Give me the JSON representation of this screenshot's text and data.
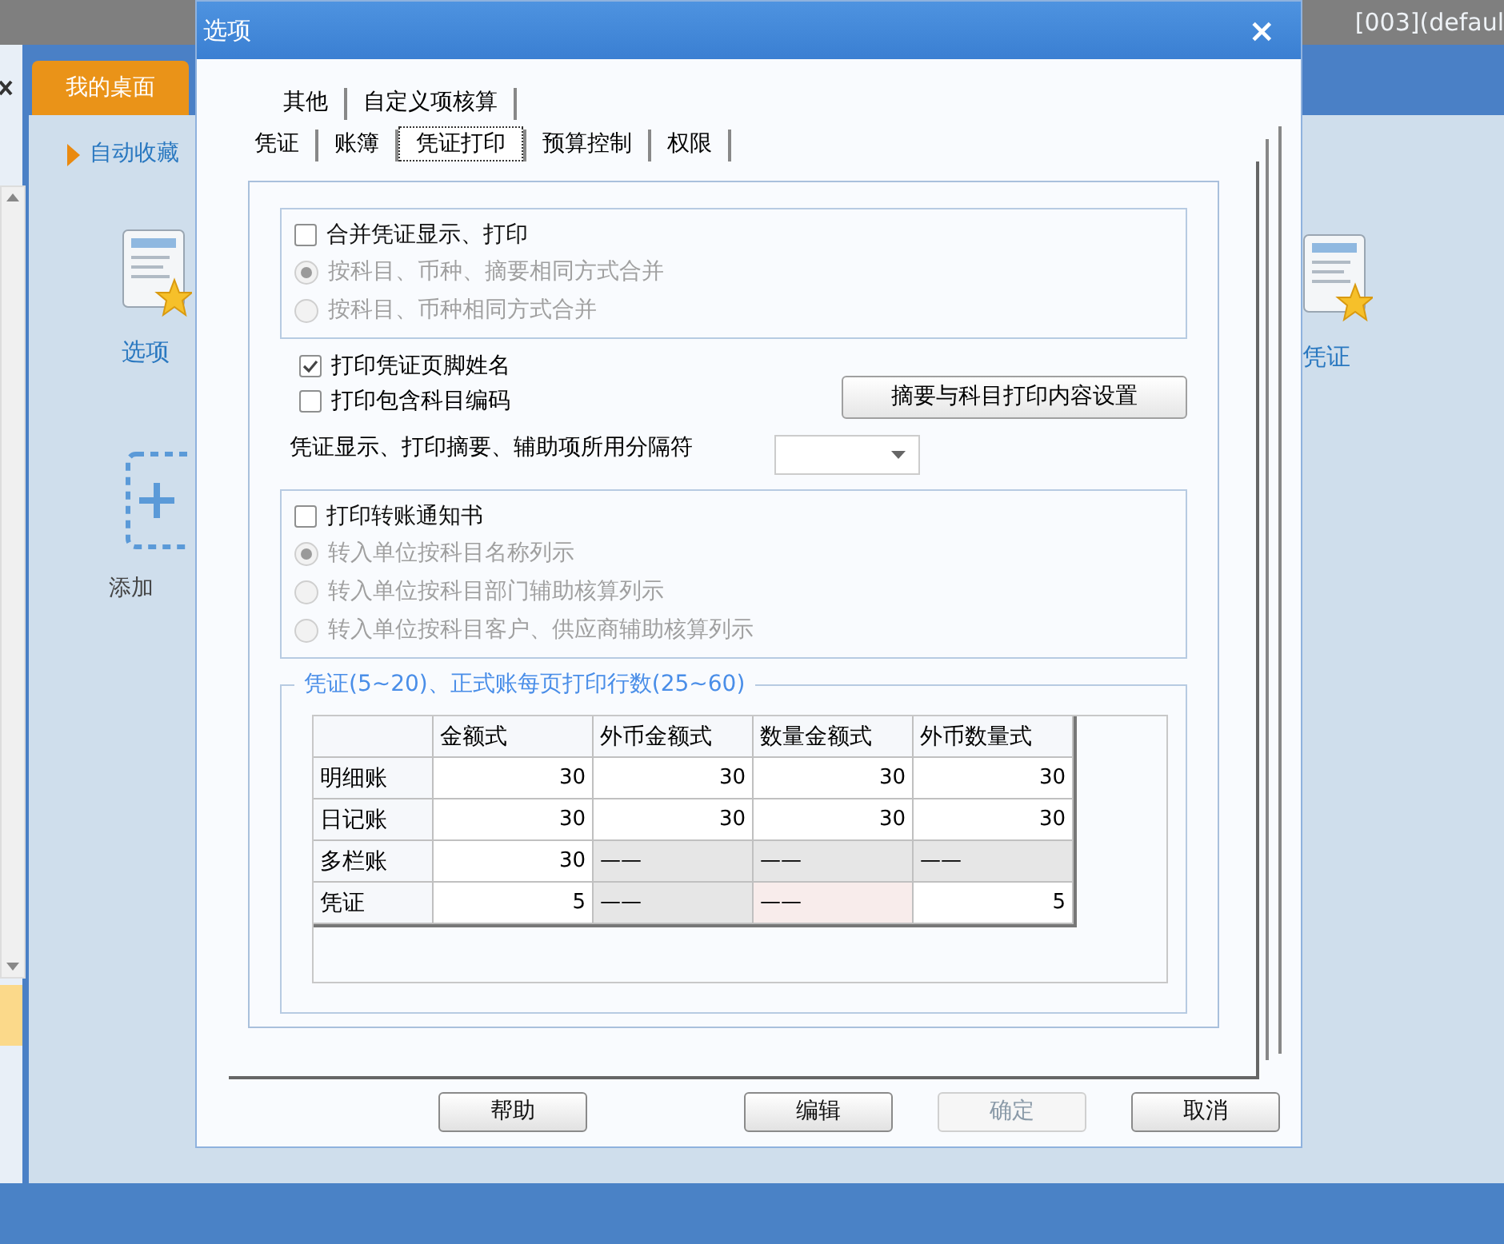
{
  "app": {
    "account": "[003](defaul",
    "desktop_tab": "我的桌面",
    "favorites": "自动收藏",
    "shortcuts": [
      {
        "label": "选项",
        "kind": "doc"
      },
      {
        "label": "添加",
        "kind": "add"
      }
    ],
    "right_shortcut": {
      "label": "凭证",
      "kind": "doc"
    }
  },
  "dialog": {
    "title": "选项",
    "close": "×",
    "tab_rows": [
      [
        {
          "label": "其他",
          "selected": false
        },
        {
          "label": "自定义项核算",
          "selected": false
        }
      ],
      [
        {
          "label": "凭证",
          "selected": false
        },
        {
          "label": "账簿",
          "selected": false
        },
        {
          "label": "凭证打印",
          "selected": true
        },
        {
          "label": "预算控制",
          "selected": false
        },
        {
          "label": "权限",
          "selected": false
        }
      ]
    ],
    "merge_group": {
      "checkbox": {
        "label": "合并凭证显示、打印",
        "checked": false
      },
      "radios": [
        {
          "label": "按科目、币种、摘要相同方式合并",
          "selected": true,
          "disabled": true
        },
        {
          "label": "按科目、币种相同方式合并",
          "selected": false,
          "disabled": true
        }
      ]
    },
    "options": [
      {
        "label": "打印凭证页脚姓名",
        "checked": true
      },
      {
        "label": "打印包含科目编码",
        "checked": false
      }
    ],
    "settings_button": "摘要与科目打印内容设置",
    "separator_label": "凭证显示、打印摘要、辅助项所用分隔符",
    "transfer_group": {
      "checkbox": {
        "label": "打印转账通知书",
        "checked": false
      },
      "radios": [
        {
          "label": "转入单位按科目名称列示",
          "selected": true,
          "disabled": true
        },
        {
          "label": "转入单位按科目部门辅助核算列示",
          "selected": false,
          "disabled": true
        },
        {
          "label": "转入单位按科目客户、供应商辅助核算列示",
          "selected": false,
          "disabled": true
        }
      ]
    },
    "lines_group": {
      "legend": "凭证(5~20)、正式账每页打印行数(25~60)",
      "columns": [
        "金额式",
        "外币金额式",
        "数量金额式",
        "外币数量式"
      ],
      "rows": [
        {
          "label": "明细账",
          "cells": [
            {
              "text": "30",
              "kind": "value"
            },
            {
              "text": "30",
              "kind": "value"
            },
            {
              "text": "30",
              "kind": "value"
            },
            {
              "text": "30",
              "kind": "value"
            }
          ]
        },
        {
          "label": "日记账",
          "cells": [
            {
              "text": "30",
              "kind": "value"
            },
            {
              "text": "30",
              "kind": "value"
            },
            {
              "text": "30",
              "kind": "value"
            },
            {
              "text": "30",
              "kind": "value"
            }
          ]
        },
        {
          "label": "多栏账",
          "cells": [
            {
              "text": "30",
              "kind": "value"
            },
            {
              "text": "——",
              "kind": "disabled"
            },
            {
              "text": "——",
              "kind": "disabled"
            },
            {
              "text": "——",
              "kind": "disabled"
            }
          ]
        },
        {
          "label": "凭证",
          "cells": [
            {
              "text": "5",
              "kind": "value"
            },
            {
              "text": "——",
              "kind": "disabled"
            },
            {
              "text": "——",
              "kind": "current"
            },
            {
              "text": "5",
              "kind": "value"
            }
          ]
        }
      ]
    },
    "buttons": [
      {
        "label": "帮助",
        "disabled": false
      },
      {
        "label": "编辑",
        "disabled": false
      },
      {
        "label": "确定",
        "disabled": true
      },
      {
        "label": "取消",
        "disabled": false
      }
    ]
  }
}
